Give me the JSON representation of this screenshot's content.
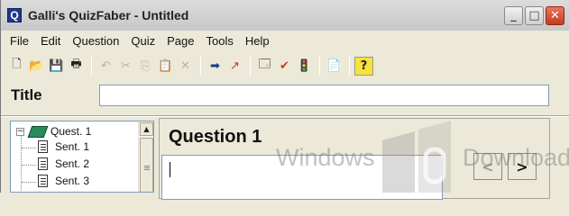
{
  "window": {
    "title": "Galli's QuizFaber - Untitled",
    "app_icon_letter": "Q",
    "controls": {
      "minimize": "_",
      "maximize": "□",
      "close": "✕"
    }
  },
  "menu": [
    "File",
    "Edit",
    "Question",
    "Quiz",
    "Page",
    "Tools",
    "Help"
  ],
  "toolbar": [
    {
      "name": "new-file-icon",
      "glyph": "🗋",
      "enabled": true
    },
    {
      "name": "open-folder-icon",
      "glyph": "📂",
      "enabled": true
    },
    {
      "name": "save-icon",
      "glyph": "💾",
      "enabled": true
    },
    {
      "name": "print-icon",
      "glyph": "🖶",
      "enabled": true
    },
    {
      "name": "undo-icon",
      "glyph": "↶",
      "enabled": false
    },
    {
      "name": "cut-icon",
      "glyph": "✂",
      "enabled": false
    },
    {
      "name": "copy-icon",
      "glyph": "⎘",
      "enabled": false
    },
    {
      "name": "paste-icon",
      "glyph": "📋",
      "enabled": true
    },
    {
      "name": "delete-icon",
      "glyph": "✕",
      "enabled": false
    },
    {
      "name": "arrow-right-icon",
      "glyph": "➡",
      "enabled": true
    },
    {
      "name": "arrow-up-right-icon",
      "glyph": "↗",
      "enabled": true
    },
    {
      "name": "properties-icon",
      "glyph": "🗔",
      "enabled": true
    },
    {
      "name": "check-icon",
      "glyph": "✔",
      "enabled": true
    },
    {
      "name": "traffic-light-icon",
      "glyph": "🚦",
      "enabled": true
    },
    {
      "name": "document-list-icon",
      "glyph": "📄",
      "enabled": true
    },
    {
      "name": "help-icon",
      "glyph": "?",
      "enabled": true
    }
  ],
  "title_row": {
    "label": "Title",
    "value": ""
  },
  "tree": {
    "root": "Quest. 1",
    "expander": "−",
    "nodes": [
      "Sent. 1",
      "Sent. 2",
      "Sent. 3"
    ]
  },
  "question": {
    "heading": "Question 1",
    "text": ""
  },
  "navigation": {
    "prev": "<",
    "next": ">"
  },
  "watermark": {
    "left": "Windows",
    "right": "Download"
  },
  "colors": {
    "accent_red": "#c33b1f",
    "tree_book": "#2a8a5a",
    "input_border": "#7f9db9"
  }
}
